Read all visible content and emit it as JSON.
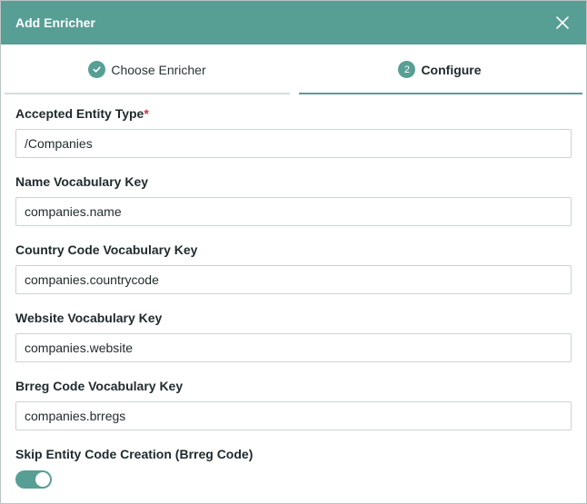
{
  "dialog": {
    "title": "Add Enricher",
    "close_icon": "close-icon"
  },
  "steps": [
    {
      "label": "Choose Enricher",
      "status": "completed",
      "icon": "check-icon"
    },
    {
      "label": "Configure",
      "number": "2",
      "status": "active"
    }
  ],
  "form": {
    "accepted_entity_type": {
      "label": "Accepted Entity Type",
      "required_marker": "*",
      "value": "/Companies"
    },
    "name_vocabulary_key": {
      "label": "Name Vocabulary Key",
      "value": "companies.name"
    },
    "country_code_vocabulary_key": {
      "label": "Country Code Vocabulary Key",
      "value": "companies.countrycode"
    },
    "website_vocabulary_key": {
      "label": "Website Vocabulary Key",
      "value": "companies.website"
    },
    "brreg_code_vocabulary_key": {
      "label": "Brreg Code Vocabulary Key",
      "value": "companies.brregs"
    },
    "skip_entity_code_creation": {
      "label": "Skip Entity Code Creation (Brreg Code)",
      "enabled": true
    }
  },
  "colors": {
    "accent": "#579f94",
    "required": "#d1323a"
  }
}
